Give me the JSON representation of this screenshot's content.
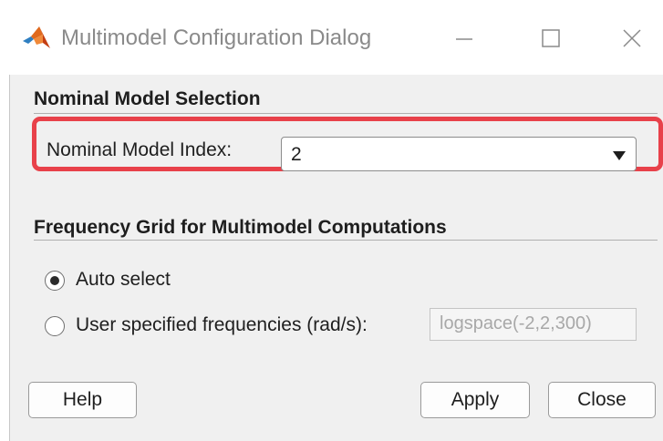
{
  "window": {
    "title": "Multimodel Configuration Dialog",
    "app_icon": "matlab-logo-icon",
    "controls": [
      "minimize-icon",
      "maximize-icon",
      "close-icon"
    ]
  },
  "nominal_section": {
    "title": "Nominal Model Selection",
    "field_label": "Nominal Model Index:",
    "selected_value": "2",
    "highlight_color": "#e8414a"
  },
  "frequency_section": {
    "title": "Frequency Grid for Multimodel Computations",
    "options": [
      {
        "label": "Auto select",
        "selected": true
      },
      {
        "label": "User specified frequencies (rad/s):",
        "selected": false
      }
    ],
    "frequency_input_value": "logspace(-2,2,300)"
  },
  "buttons": {
    "help": "Help",
    "apply": "Apply",
    "close": "Close"
  }
}
